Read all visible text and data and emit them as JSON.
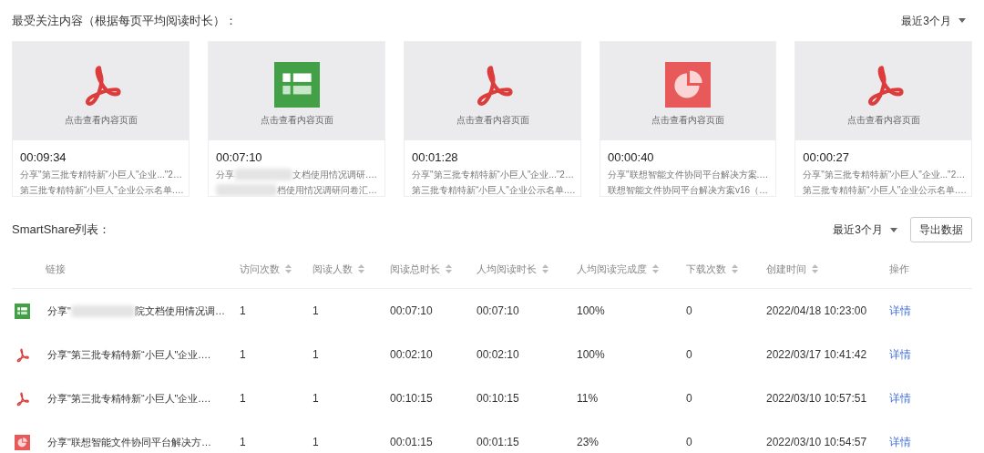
{
  "top_section": {
    "title": "最受关注内容（根据每页平均阅读时长）：",
    "range_select": "最近3个月"
  },
  "cards": [
    {
      "kind": "pdf",
      "caption": "点击查看内容页面",
      "duration": "00:09:34",
      "line_1": [
        {
          "kind": "text",
          "text": "分享\"第三批专精特新“小巨人\"企业...\"2…"
        }
      ],
      "line_2": [
        {
          "kind": "text",
          "text": "第三批专精特新“小巨人\"企业公示名单.…"
        }
      ]
    },
    {
      "kind": "sheet",
      "caption": "点击查看内容页面",
      "duration": "00:07:10",
      "line_1": [
        {
          "kind": "text",
          "text": "分享"
        },
        {
          "kind": "blur"
        },
        {
          "kind": "text",
          "text": "文档使用情况调研.…"
        }
      ],
      "line_2": [
        {
          "kind": "blur"
        },
        {
          "kind": "text",
          "text": "档使用情况调研问卷汇…"
        }
      ]
    },
    {
      "kind": "pdf",
      "caption": "点击查看内容页面",
      "duration": "00:01:28",
      "line_1": [
        {
          "kind": "text",
          "text": "分享\"第三批专精特新“小巨人\"企业...\"2…"
        }
      ],
      "line_2": [
        {
          "kind": "text",
          "text": "第三批专精特新“小巨人\"企业公示名单.…"
        }
      ]
    },
    {
      "kind": "slides",
      "caption": "点击查看内容页面",
      "duration": "00:00:40",
      "line_1": [
        {
          "kind": "text",
          "text": "分享\"联想智能文件协同平台解决方案.…"
        }
      ],
      "line_2": [
        {
          "kind": "text",
          "text": "联想智能文件协同平台解决方案v16（…"
        }
      ]
    },
    {
      "kind": "pdf",
      "caption": "点击查看内容页面",
      "duration": "00:00:27",
      "line_1": [
        {
          "kind": "text",
          "text": "分享\"第三批专精特新“小巨人\"企业...\"2…"
        }
      ],
      "line_2": [
        {
          "kind": "text",
          "text": "第三批专精特新“小巨人\"企业公示名单.…"
        }
      ]
    }
  ],
  "list_section": {
    "title": "SmartShare列表：",
    "range_select": "最近3个月",
    "export_button": "导出数据"
  },
  "table": {
    "columns": [
      {
        "label": "链接",
        "sortable": false
      },
      {
        "label": "访问次数",
        "sortable": true
      },
      {
        "label": "阅读人数",
        "sortable": true
      },
      {
        "label": "阅读总时长",
        "sortable": true
      },
      {
        "label": "人均阅读时长",
        "sortable": true
      },
      {
        "label": "人均阅读完成度",
        "sortable": true
      },
      {
        "label": "下载次数",
        "sortable": true
      },
      {
        "label": "创建时间",
        "sortable": true
      },
      {
        "label": "操作",
        "sortable": false
      }
    ],
    "rows": [
      {
        "kind": "sheet",
        "link": [
          {
            "kind": "text",
            "text": "分享\""
          },
          {
            "kind": "blur"
          },
          {
            "kind": "text",
            "text": "院文档使用情况调…"
          }
        ],
        "visits": "1",
        "readers": "1",
        "total_time": "00:07:10",
        "avg_time": "00:07:10",
        "completion": "100%",
        "downloads": "0",
        "created": "2022/04/18 10:23:00",
        "action": "详情"
      },
      {
        "kind": "pdf",
        "link": [
          {
            "kind": "text",
            "text": "分享\"第三批专精特新“小巨人\"企业.…"
          }
        ],
        "visits": "1",
        "readers": "1",
        "total_time": "00:02:10",
        "avg_time": "00:02:10",
        "completion": "100%",
        "downloads": "0",
        "created": "2022/03/17 10:41:42",
        "action": "详情"
      },
      {
        "kind": "pdf",
        "link": [
          {
            "kind": "text",
            "text": "分享\"第三批专精特新“小巨人\"企业.…"
          }
        ],
        "visits": "1",
        "readers": "1",
        "total_time": "00:10:15",
        "avg_time": "00:10:15",
        "completion": "11%",
        "downloads": "0",
        "created": "2022/03/10 10:57:51",
        "action": "详情"
      },
      {
        "kind": "slides",
        "link": [
          {
            "kind": "text",
            "text": "分享\"联想智能文件协同平台解决方…"
          }
        ],
        "visits": "1",
        "readers": "1",
        "total_time": "00:01:15",
        "avg_time": "00:01:15",
        "completion": "23%",
        "downloads": "0",
        "created": "2022/03/10 10:54:57",
        "action": "详情"
      }
    ]
  }
}
